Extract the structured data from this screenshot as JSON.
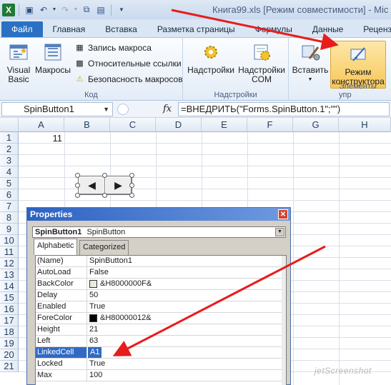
{
  "title_bar": {
    "title": "Книга99.xls  [Режим совместимости]  -  Mic",
    "app_icon": "excel-icon"
  },
  "tabs": [
    {
      "label": "Файл"
    },
    {
      "label": "Главная"
    },
    {
      "label": "Вставка"
    },
    {
      "label": "Разметка страницы"
    },
    {
      "label": "Формулы"
    },
    {
      "label": "Данные"
    },
    {
      "label": "Рецензиро"
    }
  ],
  "ribbon": {
    "code_group": {
      "label": "Код",
      "visual_basic": "Visual\nBasic",
      "macros": "Макросы",
      "record_macro": "Запись макроса",
      "relative_refs": "Относительные ссылки",
      "macro_security": "Безопасность макросов"
    },
    "addins_group": {
      "label": "Надстройки",
      "addins": "Надстройки",
      "com_addins": "Надстройки\nCOM"
    },
    "controls_group": {
      "label": "Элементы упр",
      "insert": "Вставить",
      "design_mode": "Режим\nконструктора"
    }
  },
  "formula_bar": {
    "name_box": "SpinButton1",
    "fx": "fx",
    "formula": "=ВНЕДРИТЬ(\"Forms.SpinButton.1\";\"\")"
  },
  "sheet": {
    "columns": [
      "A",
      "B",
      "C",
      "D",
      "E",
      "F",
      "G",
      "H"
    ],
    "rows": [
      "1",
      "2",
      "3",
      "4",
      "5",
      "6",
      "7",
      "8",
      "9",
      "10",
      "11",
      "12",
      "13",
      "14",
      "15",
      "16",
      "17",
      "18",
      "19",
      "20",
      "21"
    ],
    "a1_value": "11"
  },
  "spin_button": {
    "left_glyph": "◀",
    "right_glyph": "▶"
  },
  "properties": {
    "title": "Properties",
    "close": "✕",
    "object_name": "SpinButton1",
    "object_type": "SpinButton",
    "tabs": [
      "Alphabetic",
      "Categorized"
    ],
    "rows": [
      {
        "name": "(Name)",
        "value": "SpinButton1"
      },
      {
        "name": "AutoLoad",
        "value": "False"
      },
      {
        "name": "BackColor",
        "value": "&H8000000F&",
        "swatch": "#ece9d8"
      },
      {
        "name": "Delay",
        "value": "50"
      },
      {
        "name": "Enabled",
        "value": "True"
      },
      {
        "name": "ForeColor",
        "value": "&H80000012&",
        "swatch": "#000000"
      },
      {
        "name": "Height",
        "value": "21"
      },
      {
        "name": "Left",
        "value": "63"
      },
      {
        "name": "LinkedCell",
        "value": "A1",
        "selected": true
      },
      {
        "name": "Locked",
        "value": "True"
      },
      {
        "name": "Max",
        "value": "100"
      }
    ]
  },
  "watermark": "jetScreenshot",
  "colors": {
    "accent_red": "#e81c1c",
    "file_tab": "#2a71c4",
    "selection": "#316ac5"
  }
}
